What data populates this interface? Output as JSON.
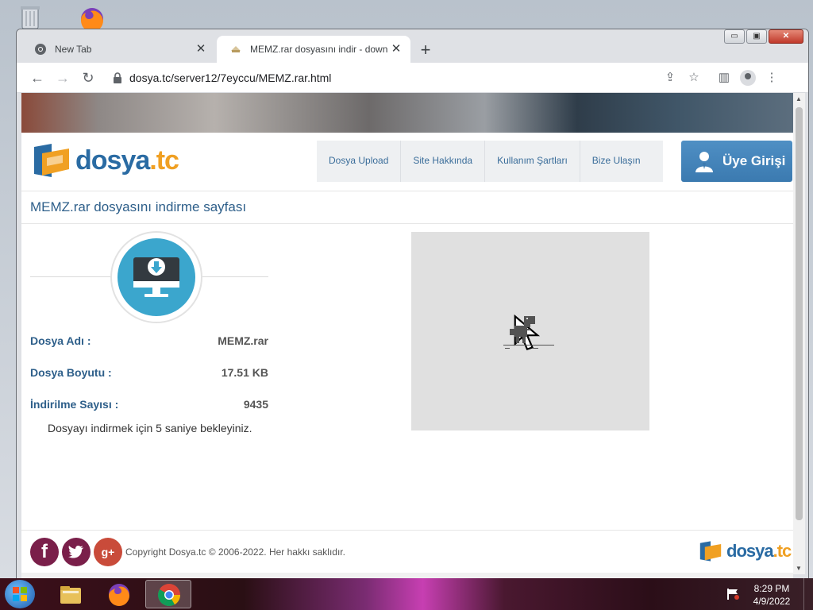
{
  "browser": {
    "tabs": [
      {
        "title": "New Tab",
        "active": false,
        "icon": "chrome-icon"
      },
      {
        "title": "MEMZ.rar dosyasını indir - downl",
        "active": true,
        "icon": "page-icon"
      }
    ],
    "new_tab": "+",
    "close_glyph": "✕",
    "url": "dosya.tc/server12/7eyccu/MEMZ.rar.html",
    "window_controls": {
      "minimize": "▭",
      "maximize": "▣",
      "close": "✕"
    }
  },
  "site": {
    "logo_part1": "dosya",
    "logo_part2": ".tc",
    "menu": [
      "Dosya Upload",
      "Site Hakkında",
      "Kullanım Şartları",
      "Bize Ulaşın"
    ],
    "login": "Üye Girişi",
    "page_title": "MEMZ.rar dosyasını indirme sayfası",
    "info": {
      "name_label": "Dosya Adı :",
      "name_value": "MEMZ.rar",
      "size_label": "Dosya Boyutu :",
      "size_value": "17.51 KB",
      "count_label": "İndirilme Sayısı :",
      "count_value": "9435"
    },
    "wait_message": "Dosyayı indirmek için 5 saniye bekleyiniz.",
    "copyright": "Copyright Dosya.tc © 2006-2022. Her hakkı saklıdır.",
    "social": {
      "facebook": "f",
      "gplus": "g+"
    }
  },
  "taskbar": {
    "time": "8:29 PM",
    "date": "4/9/2022"
  },
  "colors": {
    "brand_blue": "#2a6ba3",
    "brand_orange": "#f0a023",
    "download_circle": "#3ba6cd",
    "login_button": "#4584bb"
  }
}
